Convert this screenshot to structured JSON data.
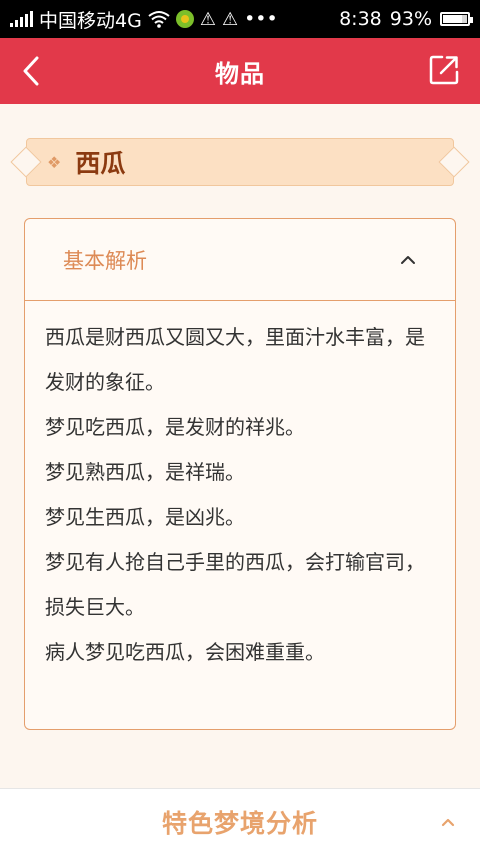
{
  "status_bar": {
    "carrier": "中国移动4G",
    "dots": "•••",
    "time": "8:38",
    "battery": "93%"
  },
  "header": {
    "title": "物品"
  },
  "item": {
    "name": "西瓜"
  },
  "basic_analysis": {
    "title": "基本解析",
    "paragraphs": [
      "西瓜是财西瓜又圆又大，里面汁水丰富，是发财的象征。",
      "梦见吃西瓜，是发财的祥兆。",
      "梦见熟西瓜，是祥瑞。",
      "梦见生西瓜，是凶兆。",
      "梦见有人抢自己手里的西瓜，会打输官司，损失巨大。",
      "病人梦见吃西瓜，会困难重重。"
    ]
  },
  "bottom_section": {
    "title": "特色梦境分析"
  },
  "colors": {
    "header_bg": "#e2394a",
    "accent": "#e49e6c",
    "banner_bg": "#fce0c3",
    "item_name": "#8b3a10"
  }
}
